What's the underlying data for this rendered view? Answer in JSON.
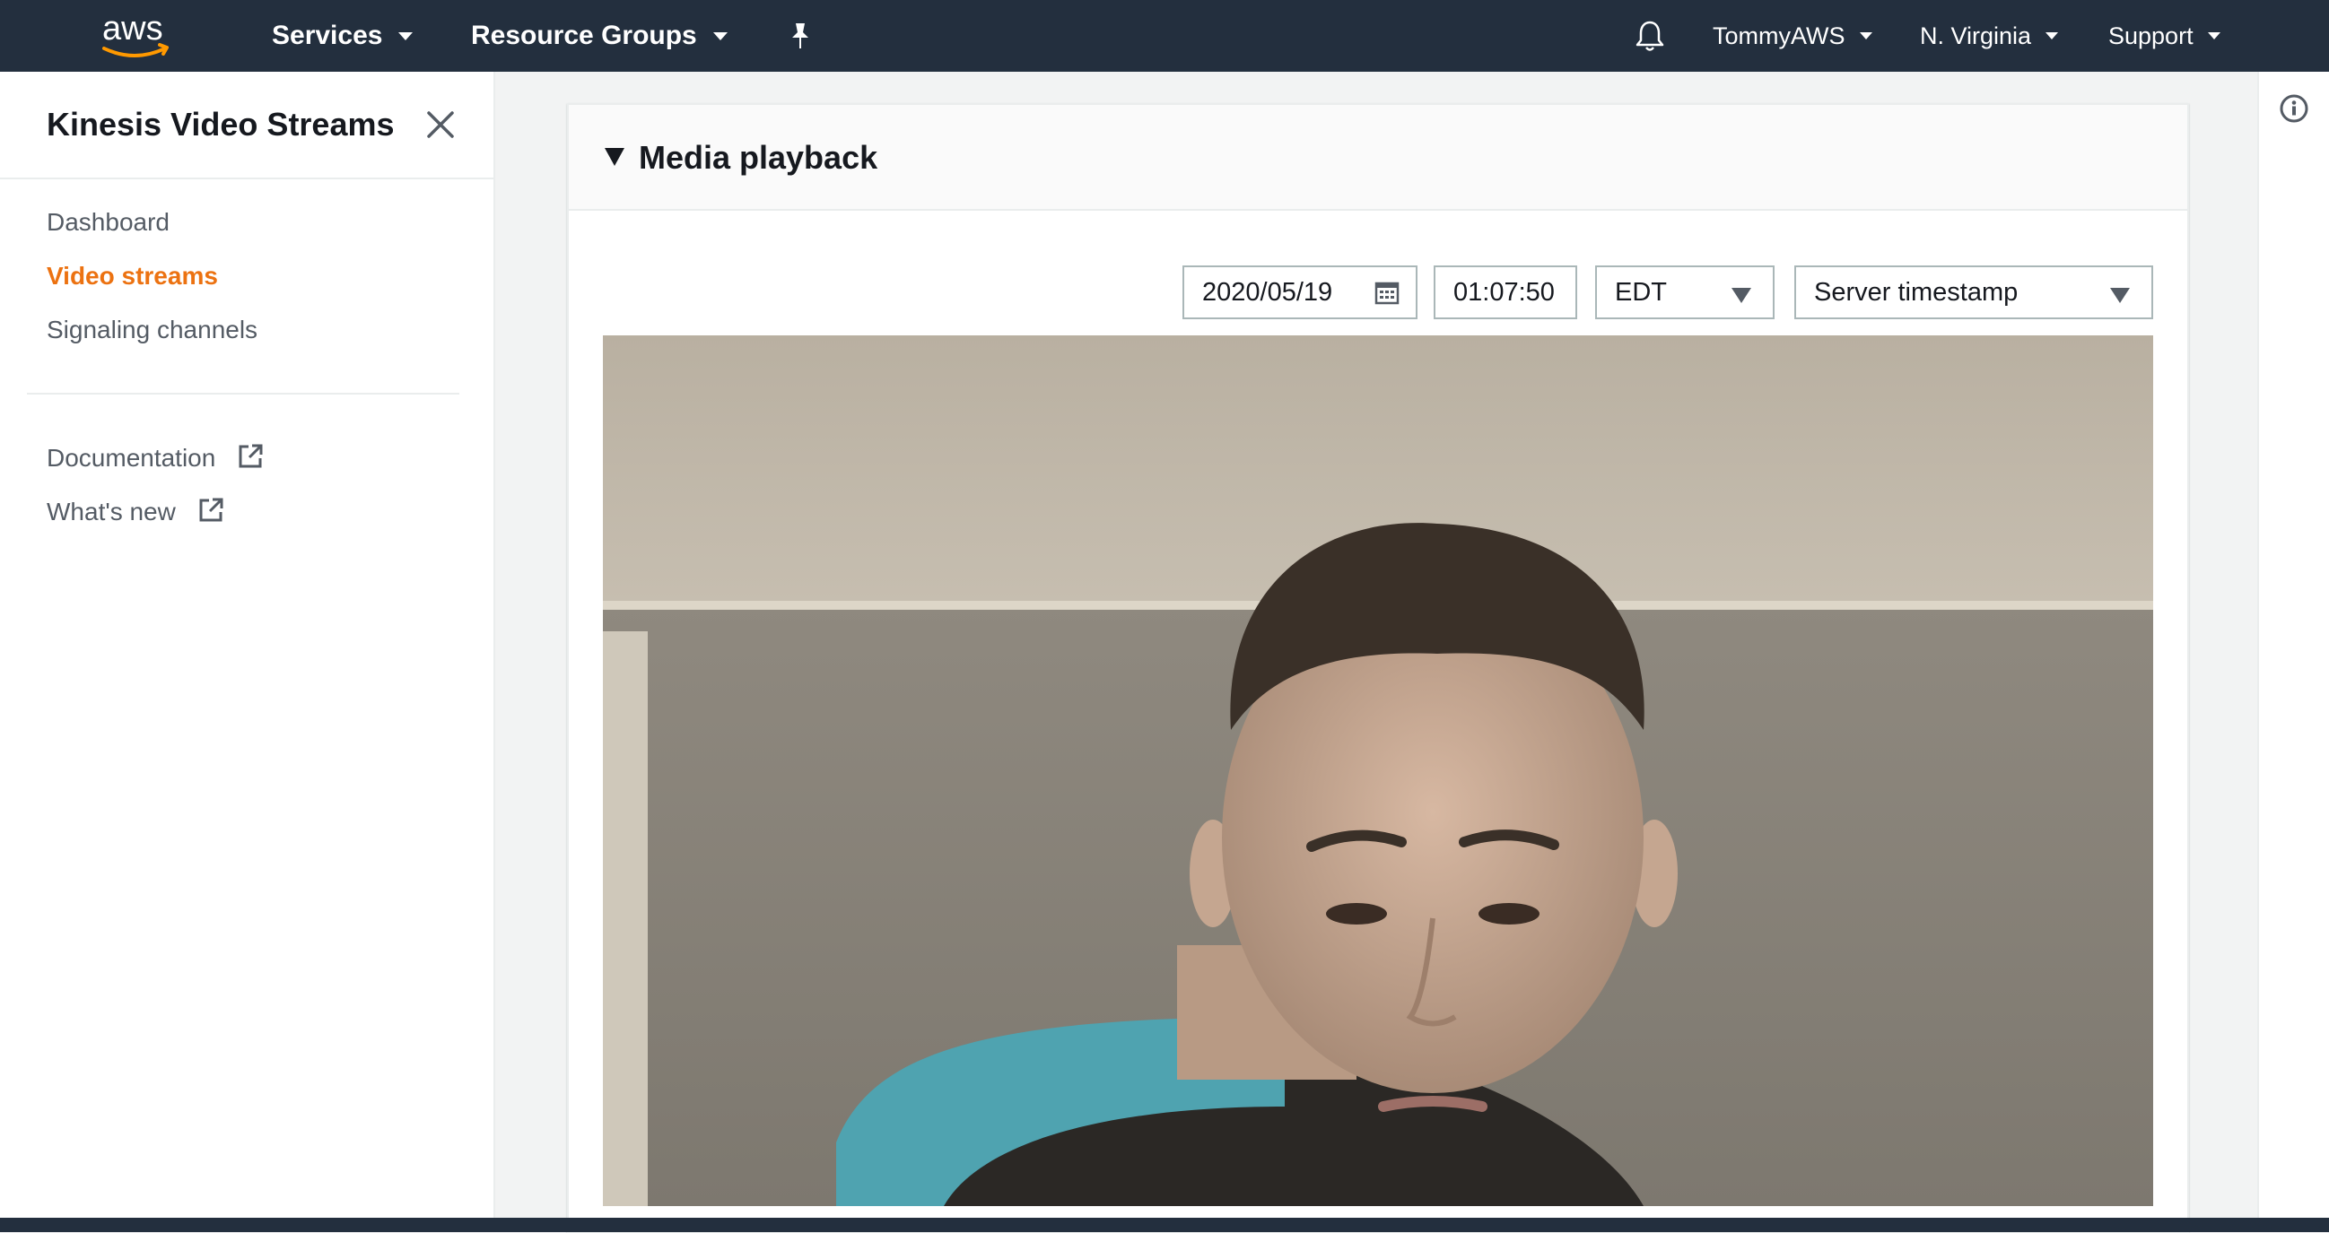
{
  "topnav": {
    "logo_text": "aws",
    "services_label": "Services",
    "resource_groups_label": "Resource Groups",
    "pin_icon": "pin-icon",
    "bell_icon": "bell-icon",
    "account_label": "TommyAWS",
    "region_label": "N. Virginia",
    "support_label": "Support"
  },
  "sidebar": {
    "title": "Kinesis Video Streams",
    "items": [
      {
        "label": "Dashboard",
        "active": false
      },
      {
        "label": "Video streams",
        "active": true
      },
      {
        "label": "Signaling channels",
        "active": false
      }
    ],
    "links": [
      {
        "label": "Documentation",
        "icon": "external-link-icon"
      },
      {
        "label": "What's new",
        "icon": "external-link-icon"
      }
    ]
  },
  "panel": {
    "title": "Media playback",
    "date_value": "2020/05/19",
    "time_value": "01:07:50",
    "timezone_value": "EDT",
    "timestamp_type_value": "Server timestamp"
  },
  "colors": {
    "nav_bg": "#232f3e",
    "accent": "#ec7211",
    "logo_smile": "#ff9900"
  }
}
